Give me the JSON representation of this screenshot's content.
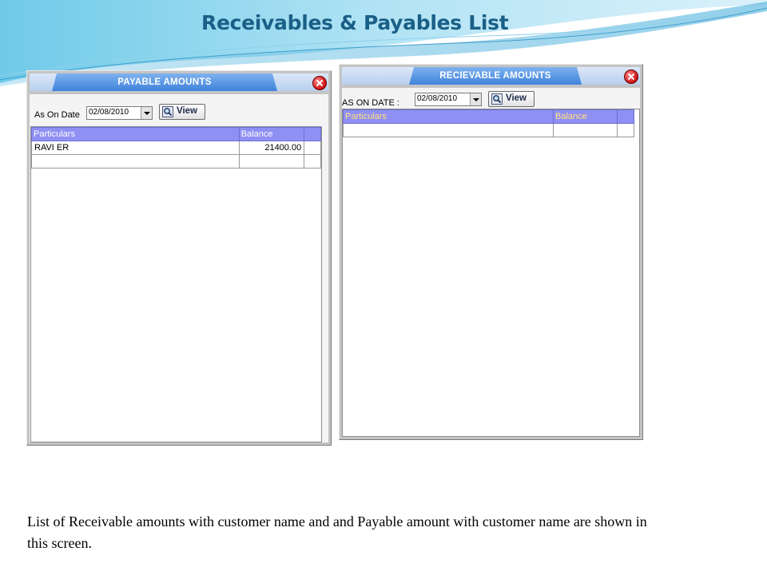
{
  "slide": {
    "title": "Receivables & Payables List",
    "caption": "List of  Receivable amounts with customer name and  and Payable amount with customer name are shown in this screen."
  },
  "payable_window": {
    "title": "PAYABLE  AMOUNTS",
    "date_label": "As On Date",
    "date_value": "02/08/2010",
    "view_label": "View",
    "columns": [
      "Particulars",
      "Balance"
    ],
    "rows": [
      {
        "particulars": "RAVI ER",
        "balance": "21400.00"
      },
      {
        "particulars": "",
        "balance": ""
      }
    ]
  },
  "receivable_window": {
    "title": "RECIEVABLE AMOUNTS",
    "date_label": "AS ON DATE :",
    "date_value": "02/08/2010",
    "view_label": "View",
    "columns": [
      "Particulars",
      "Balance"
    ],
    "rows": [
      {
        "particulars": "",
        "balance": ""
      }
    ]
  },
  "colors": {
    "title_text": "#1a5f86",
    "grid_header": "#8f8ff4",
    "header_text_receivable": "#ffe27a",
    "close_button": "#d01010",
    "titlebar_tab": "#3f82dc"
  },
  "icons": [
    "close-icon",
    "dropdown-arrow-icon",
    "magnifier-icon"
  ]
}
